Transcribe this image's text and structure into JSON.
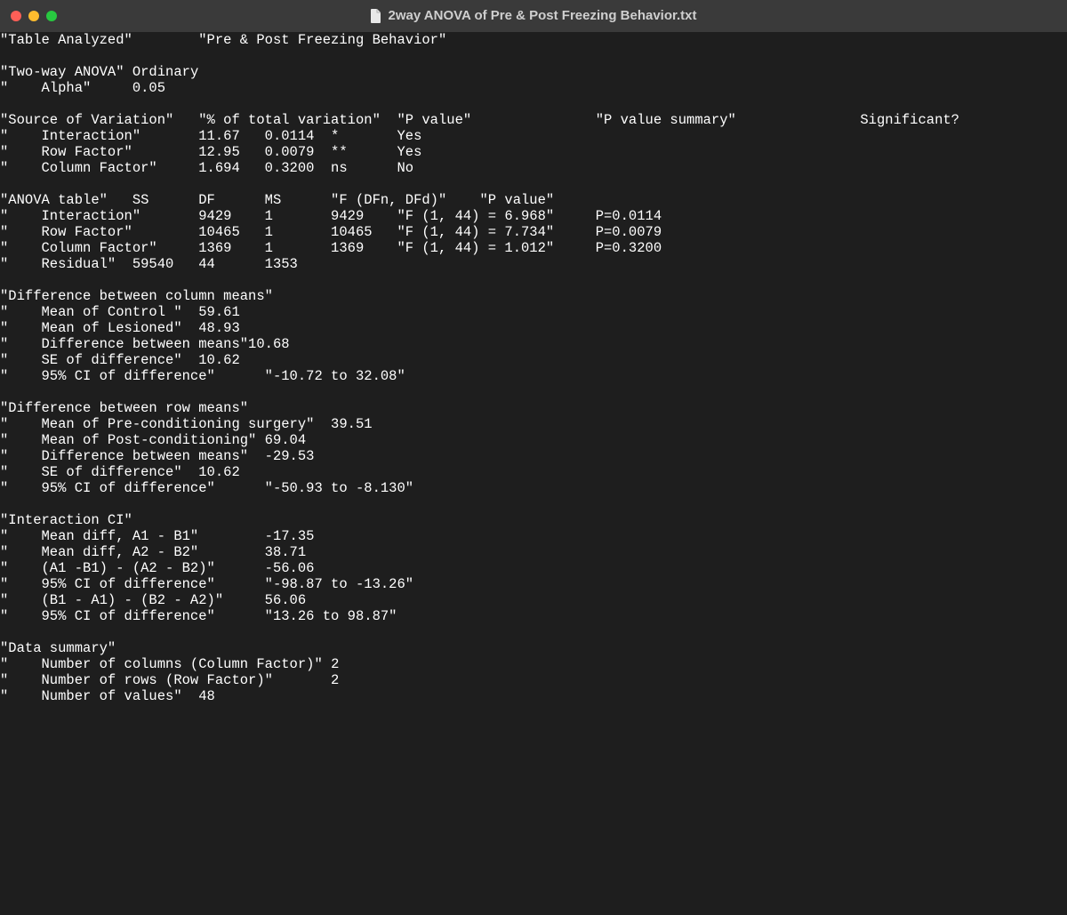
{
  "window": {
    "title": "2way ANOVA of Pre & Post Freezing Behavior.txt"
  },
  "header": {
    "table_analyzed_label": "Table Analyzed",
    "table_analyzed_value": "Pre & Post Freezing Behavior",
    "two_way_label": "Two-way ANOVA",
    "two_way_value": "Ordinary",
    "alpha_label": "    Alpha",
    "alpha_value": "0.05"
  },
  "sov": {
    "header": {
      "c0": "Source of Variation",
      "c1": "% of total variation",
      "c2": "P value",
      "c3": "P value summary",
      "c4": "Significant?"
    },
    "rows": [
      {
        "name": "    Interaction",
        "pct": "11.67",
        "p": "0.0114",
        "sum": "*",
        "sig": "Yes"
      },
      {
        "name": "    Row Factor",
        "pct": "12.95",
        "p": "0.0079",
        "sum": "**",
        "sig": "Yes"
      },
      {
        "name": "    Column Factor",
        "pct": "1.694",
        "p": "0.3200",
        "sum": "ns",
        "sig": "No"
      }
    ]
  },
  "anova": {
    "header": {
      "c0": "ANOVA table",
      "c1": "SS",
      "c2": "DF",
      "c3": "MS",
      "c4": "F (DFn, DFd)",
      "c5": "P value"
    },
    "rows": [
      {
        "name": "    Interaction",
        "ss": "9429",
        "df": "1",
        "ms": "9429",
        "f": "F (1, 44) = 6.968",
        "p": "P=0.0114"
      },
      {
        "name": "    Row Factor",
        "ss": "10465",
        "df": "1",
        "ms": "10465",
        "f": "F (1, 44) = 7.734",
        "p": "P=0.0079"
      },
      {
        "name": "    Column Factor",
        "ss": "1369",
        "df": "1",
        "ms": "1369",
        "f": "F (1, 44) = 1.012",
        "p": "P=0.3200"
      },
      {
        "name": "    Residual",
        "ss": "59540",
        "df": "44",
        "ms": "1353",
        "f": "",
        "p": ""
      }
    ]
  },
  "col_means": {
    "title": "Difference between column means",
    "rows": [
      {
        "label": "    Mean of Control ",
        "val": "59.61"
      },
      {
        "label": "    Mean of Lesioned",
        "val": "48.93"
      },
      {
        "label": "    Difference between means",
        "val": "10.68"
      },
      {
        "label": "    SE of difference",
        "val": "10.62"
      },
      {
        "label": "    95% CI of difference",
        "val": "\"-10.72 to 32.08\""
      }
    ]
  },
  "row_means": {
    "title": "Difference between row means",
    "rows": [
      {
        "label": "    Mean of Pre-conditioning surgery",
        "val": "39.51"
      },
      {
        "label": "    Mean of Post-conditioning",
        "val": "69.04"
      },
      {
        "label": "    Difference between means",
        "val": "-29.53"
      },
      {
        "label": "    SE of difference",
        "val": "10.62"
      },
      {
        "label": "    95% CI of difference",
        "val": "\"-50.93 to -8.130\""
      }
    ]
  },
  "interaction_ci": {
    "title": "Interaction CI",
    "rows": [
      {
        "label": "    Mean diff, A1 - B1",
        "val": "-17.35"
      },
      {
        "label": "    Mean diff, A2 - B2",
        "val": "38.71"
      },
      {
        "label": "    (A1 -B1) - (A2 - B2)",
        "val": "-56.06"
      },
      {
        "label": "    95% CI of difference",
        "val": "\"-98.87 to -13.26\""
      },
      {
        "label": "    (B1 - A1) - (B2 - A2)",
        "val": "56.06"
      },
      {
        "label": "    95% CI of difference",
        "val": "\"13.26 to 98.87\""
      }
    ]
  },
  "data_summary": {
    "title": "Data summary",
    "rows": [
      {
        "label": "    Number of columns (Column Factor)",
        "val": "2"
      },
      {
        "label": "    Number of rows (Row Factor)",
        "val": "2"
      },
      {
        "label": "    Number of values",
        "val": "48"
      }
    ]
  }
}
